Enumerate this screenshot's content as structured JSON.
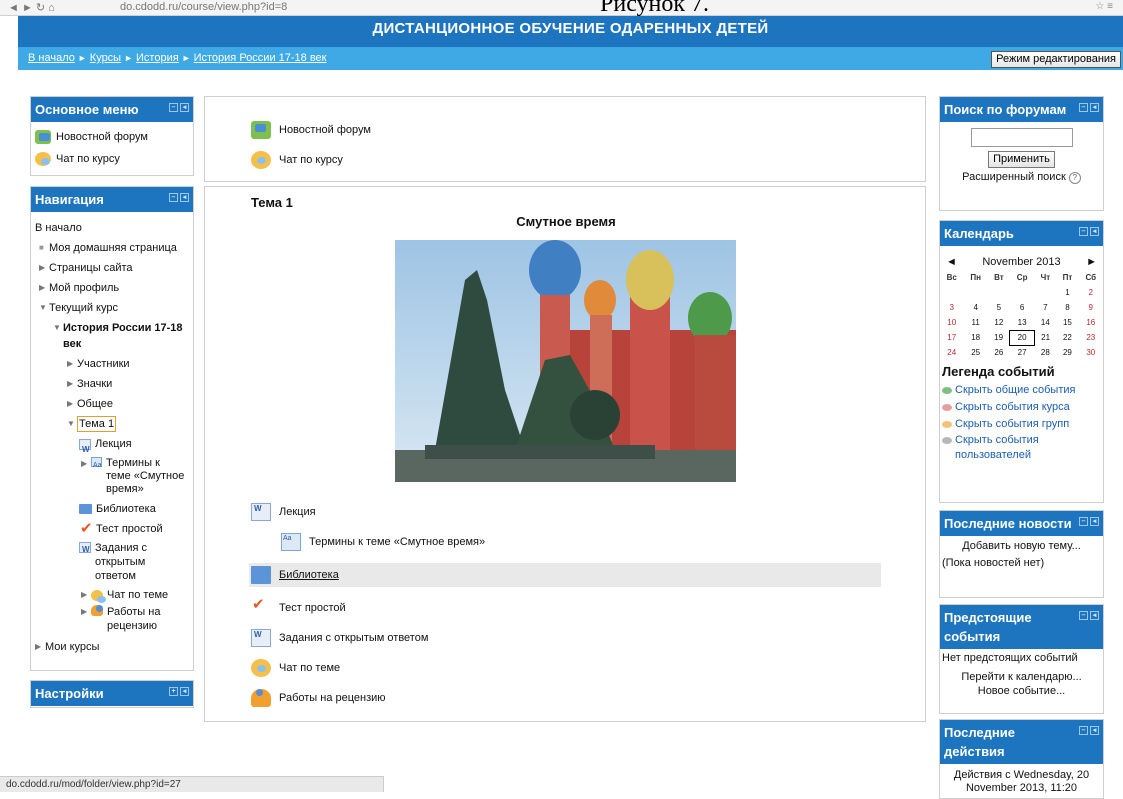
{
  "caption": "Рисунок 7.",
  "browser": {
    "url": "do.cdodd.ru/course/view.php?id=8"
  },
  "site": {
    "title": "ДИСТАНЦИОННОЕ ОБУЧЕНИЕ ОДАРЕННЫХ ДЕТЕЙ"
  },
  "breadcrumb": [
    "В начало",
    "Курсы",
    "История",
    "История России 17-18 век"
  ],
  "edit_mode_button": "Режим редактирования",
  "main_menu": {
    "title": "Основное меню",
    "items": [
      {
        "label": "Новостной форум",
        "icon": "forum-icon"
      },
      {
        "label": "Чат по курсу",
        "icon": "chat-icon"
      }
    ]
  },
  "navigation": {
    "title": "Навигация",
    "home": "В начало",
    "my_home": "Моя домашняя страница",
    "site_pages": "Страницы сайта",
    "my_profile": "Мой профиль",
    "current_course": "Текущий курс",
    "course_name": "История России 17-18 век",
    "participants": "Участники",
    "badges": "Значки",
    "general": "Общее",
    "topic": "Тема 1",
    "topic_items": [
      "Лекция",
      "Термины к теме «Смутное время»",
      "Библиотека",
      "Тест простой",
      "Задания с открытым ответом",
      "Чат по теме",
      "Работы на рецензию"
    ],
    "my_courses": "Мои курсы"
  },
  "settings_block": {
    "title": "Настройки"
  },
  "main": {
    "top_items": [
      "Новостной форум",
      "Чат по курсу"
    ],
    "section_title": "Тема 1",
    "summary_title": "Смутное время",
    "activities": [
      {
        "label": "Лекция",
        "icon": "page-icon"
      },
      {
        "label": "Термины к теме «Смутное время»",
        "icon": "glossary-icon"
      },
      {
        "label": "Библиотека",
        "icon": "folder-icon"
      },
      {
        "label": "Тест простой",
        "icon": "quiz-icon"
      },
      {
        "label": "Задания с открытым ответом",
        "icon": "page-icon"
      },
      {
        "label": "Чат по теме",
        "icon": "chat-icon"
      },
      {
        "label": "Работы на рецензию",
        "icon": "workshop-icon"
      }
    ]
  },
  "search_forums": {
    "title": "Поиск по форумам",
    "button": "Применить",
    "advanced": "Расширенный поиск"
  },
  "calendar": {
    "title": "Календарь",
    "month": "November 2013",
    "weekdays": [
      "Вс",
      "Пн",
      "Вт",
      "Ср",
      "Чт",
      "Пт",
      "Сб"
    ],
    "weeks": [
      [
        "",
        "",
        "",
        "",
        "",
        "1",
        "2"
      ],
      [
        "3",
        "4",
        "5",
        "6",
        "7",
        "8",
        "9"
      ],
      [
        "10",
        "11",
        "12",
        "13",
        "14",
        "15",
        "16"
      ],
      [
        "17",
        "18",
        "19",
        "20",
        "21",
        "22",
        "23"
      ],
      [
        "24",
        "25",
        "26",
        "27",
        "28",
        "29",
        "30"
      ]
    ],
    "today": "20",
    "legend_title": "Легенда событий",
    "legend": [
      {
        "label": "Скрыть общие события",
        "color": "#7fbf7f"
      },
      {
        "label": "Скрыть события курса",
        "color": "#e3a0a0"
      },
      {
        "label": "Скрыть события групп",
        "color": "#f2c27a"
      },
      {
        "label": "Скрыть события пользователей",
        "color": "#b8b8b8"
      }
    ]
  },
  "latest_news": {
    "title": "Последние новости",
    "add_topic": "Добавить новую тему...",
    "no_news": "(Пока новостей нет)"
  },
  "upcoming": {
    "title": "Предстоящие события",
    "no_events": "Нет предстоящих событий",
    "goto_calendar": "Перейти к календарю...",
    "new_event": "Новое событие..."
  },
  "recent_activity": {
    "title": "Последние действия",
    "text": "Действия с Wednesday, 20 November 2013, 11:20"
  },
  "status_bar": {
    "url": "do.cdodd.ru/mod/folder/view.php?id=27"
  }
}
